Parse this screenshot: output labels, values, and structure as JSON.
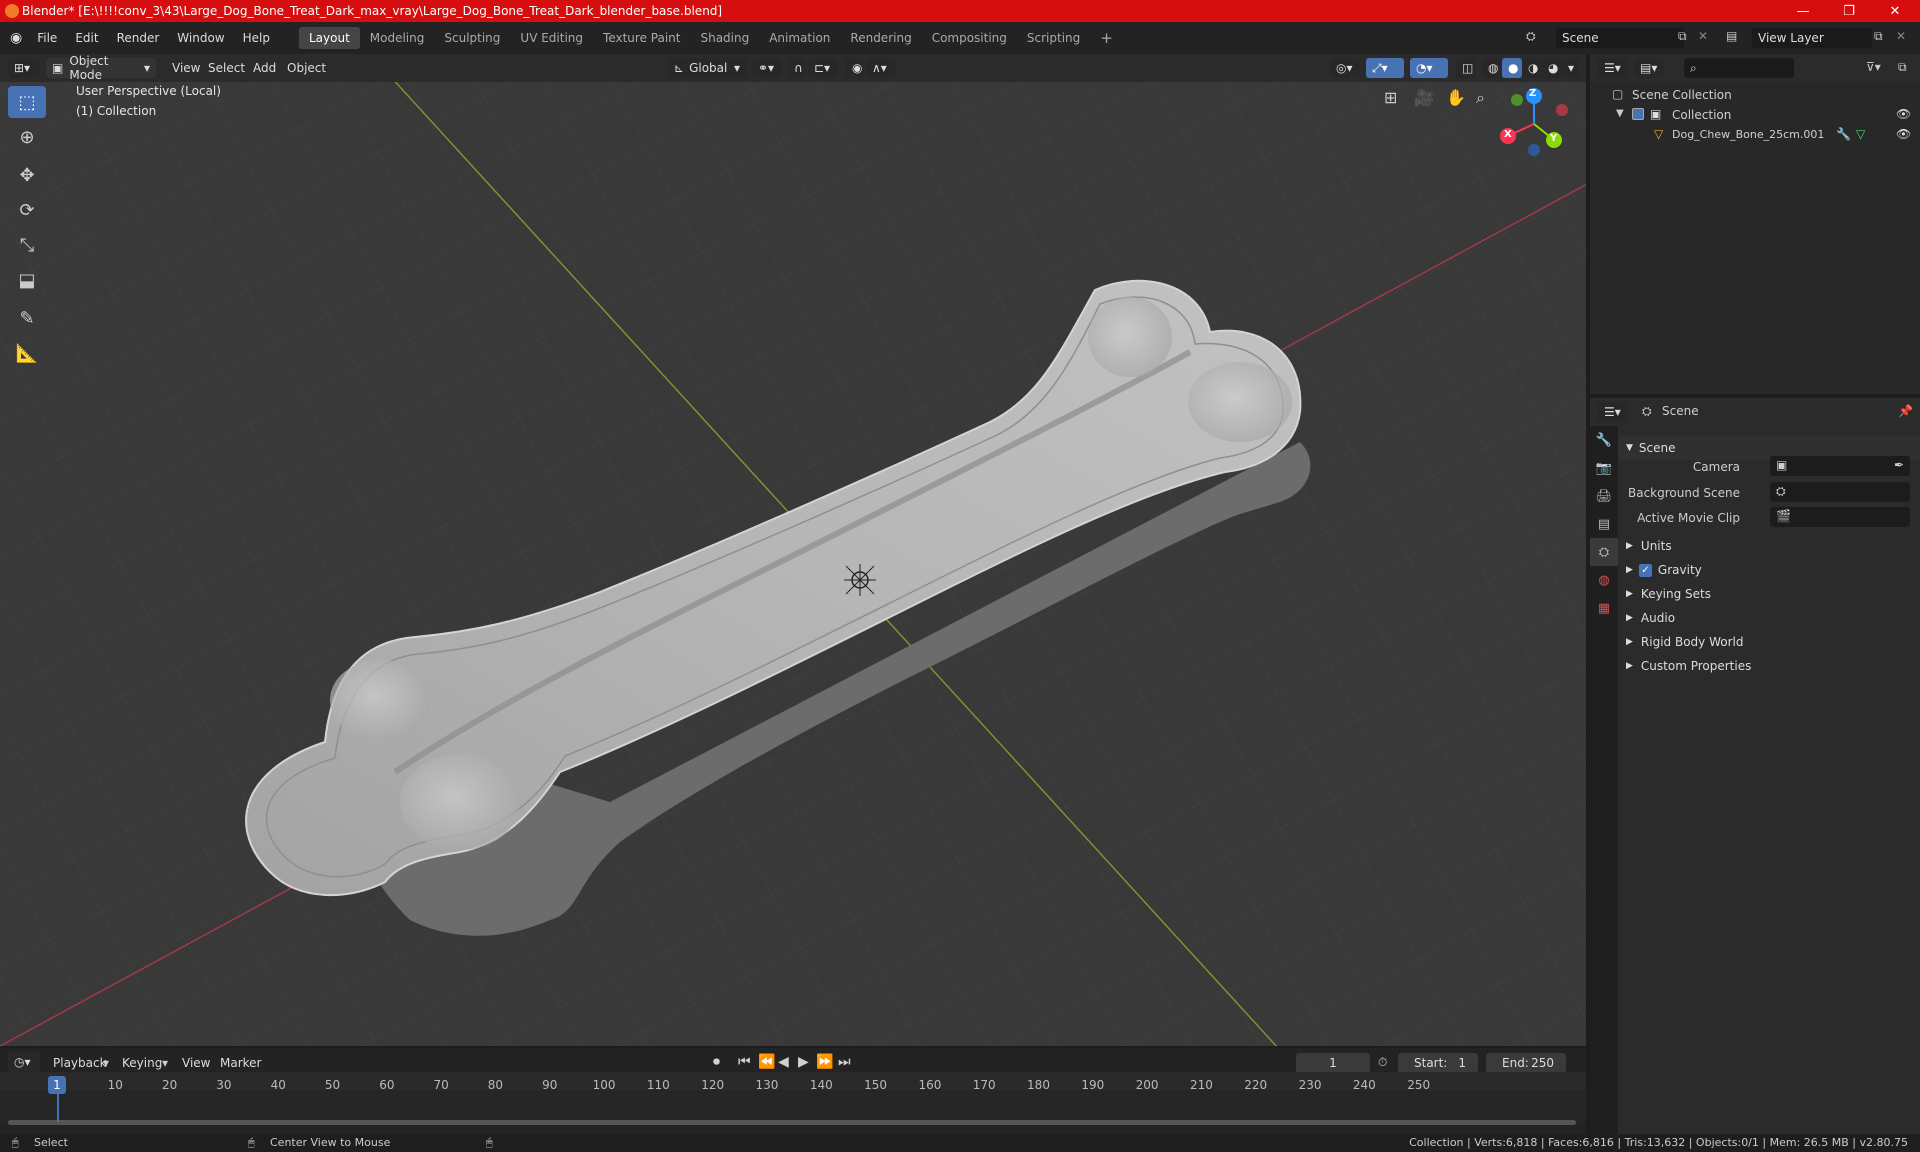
{
  "window": {
    "title": "Blender* [E:\\!!!!conv_3\\43\\Large_Dog_Bone_Treat_Dark_max_vray\\Large_Dog_Bone_Treat_Dark_blender_base.blend]"
  },
  "menu": [
    "File",
    "Edit",
    "Render",
    "Window",
    "Help"
  ],
  "workspaces": [
    "Layout",
    "Modeling",
    "Sculpting",
    "UV Editing",
    "Texture Paint",
    "Shading",
    "Animation",
    "Rendering",
    "Compositing",
    "Scripting"
  ],
  "active_workspace": "Layout",
  "scene_field": "Scene",
  "view_layer_field": "View Layer",
  "viewport_header": {
    "mode": "Object Mode",
    "menus": [
      "View",
      "Select",
      "Add",
      "Object"
    ],
    "orientation": "Global"
  },
  "viewport": {
    "view_name": "User Perspective (Local)",
    "collection_label": "(1) Collection",
    "gizmo": {
      "x": "X",
      "y": "Y",
      "z": "Z"
    }
  },
  "outliner": {
    "root": "Scene Collection",
    "collection": "Collection",
    "object": "Dog_Chew_Bone_25cm.001"
  },
  "properties": {
    "context": "Scene",
    "panel_title": "Scene",
    "camera_label": "Camera",
    "background_label": "Background Scene",
    "movie_clip_label": "Active Movie Clip",
    "sections": [
      "Units",
      "Gravity",
      "Keying Sets",
      "Audio",
      "Rigid Body World",
      "Custom Properties"
    ],
    "gravity_checked": true
  },
  "timeline": {
    "menus": [
      "Playback",
      "Keying",
      "View",
      "Marker"
    ],
    "current_frame": "1",
    "start_label": "Start:",
    "start_value": "1",
    "end_label": "End:",
    "end_value": "250",
    "ticks": [
      "10",
      "20",
      "30",
      "40",
      "50",
      "60",
      "70",
      "80",
      "90",
      "100",
      "110",
      "120",
      "130",
      "140",
      "150",
      "160",
      "170",
      "180",
      "190",
      "200",
      "210",
      "220",
      "230",
      "240",
      "250"
    ],
    "playhead": "1"
  },
  "statusbar": {
    "left": "Select",
    "middle": "Center View to Mouse",
    "right": "Collection | Verts:6,818 | Faces:6,816 | Tris:13,632 | Objects:0/1 | Mem: 26.5 MB | v2.80.75"
  },
  "colors": {
    "titlebar": "#d70e0f",
    "accent": "#4772b3",
    "x_axis": "#ff3352",
    "y_axis": "#8bdc00",
    "z_axis": "#2890ff"
  }
}
